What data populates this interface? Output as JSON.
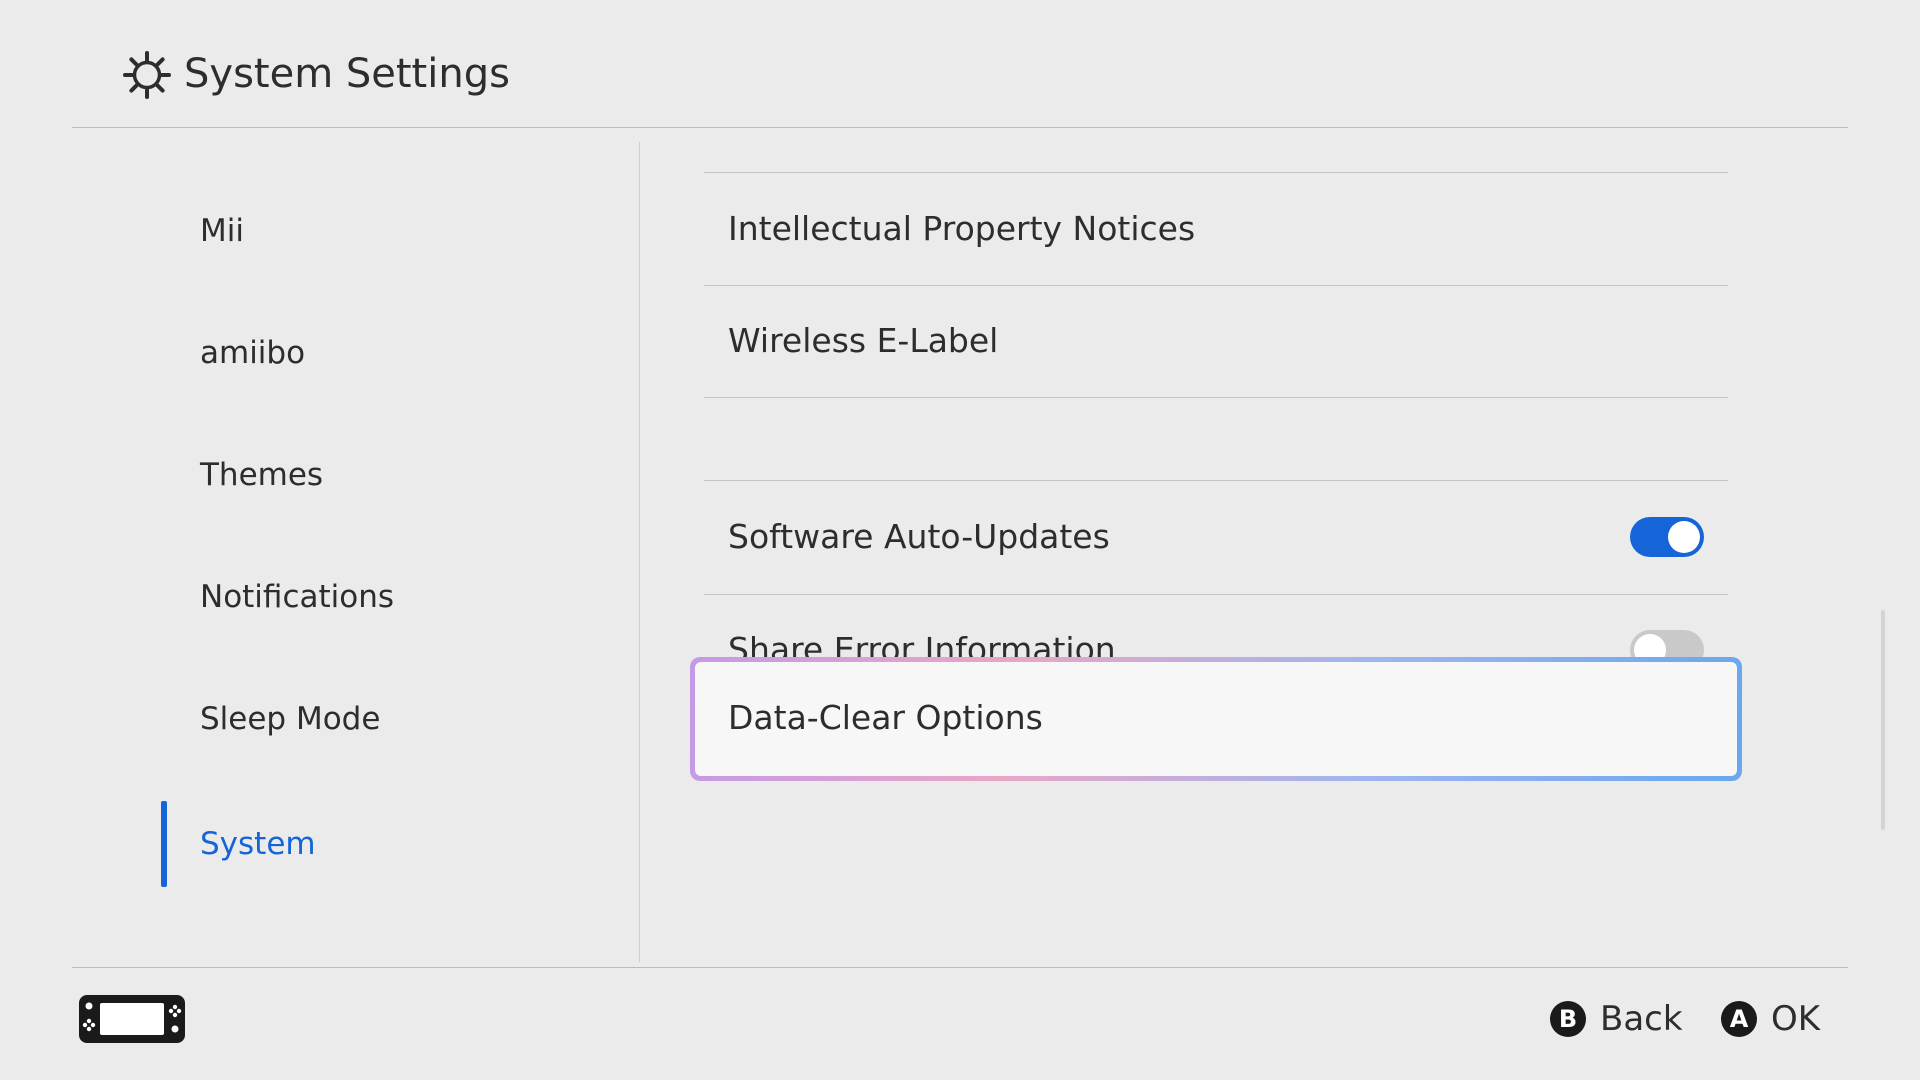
{
  "header": {
    "title": "System Settings",
    "icon": "settings-gear-icon"
  },
  "sidebar": {
    "items": [
      {
        "label": "Mii"
      },
      {
        "label": "amiibo"
      },
      {
        "label": "Themes"
      },
      {
        "label": "Notifications"
      },
      {
        "label": "Sleep Mode"
      },
      {
        "label": "System",
        "selected": true
      }
    ]
  },
  "main": {
    "rows": [
      {
        "label": "Intellectual Property Notices"
      },
      {
        "label": "Wireless E-Label"
      },
      {
        "label": "Software Auto-Updates",
        "toggle": "on"
      },
      {
        "label": "Share Error Information",
        "toggle": "off"
      }
    ],
    "focused_row": {
      "label": "Data-Clear Options"
    }
  },
  "footer": {
    "console_icon": "handheld-console-icon",
    "back": {
      "glyph": "B",
      "label": "Back"
    },
    "ok": {
      "glyph": "A",
      "label": "OK"
    }
  },
  "colors": {
    "accent": "#1565d8",
    "background": "#ebebeb",
    "text": "#2d2d2d"
  }
}
